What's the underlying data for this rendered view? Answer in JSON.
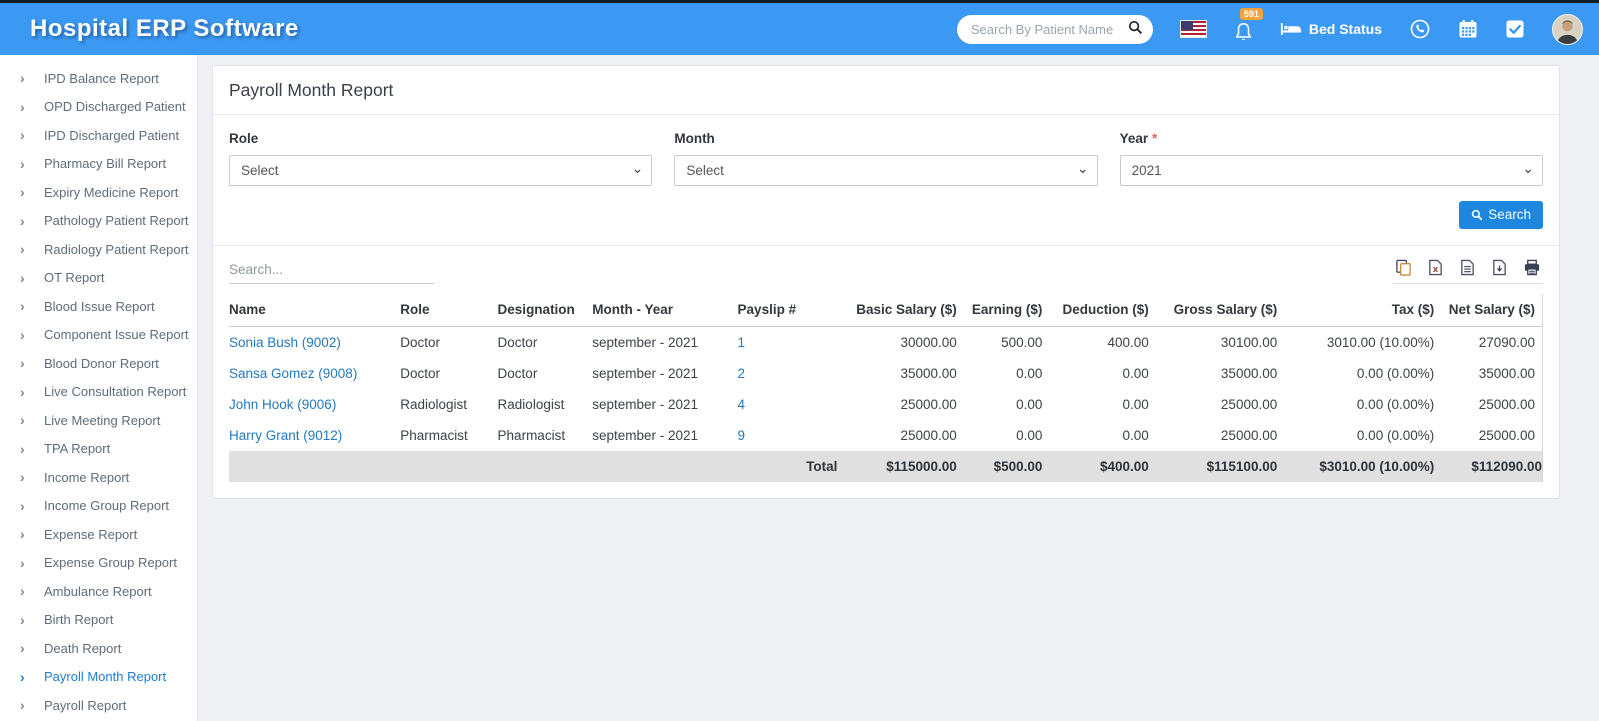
{
  "colors": {
    "header_blue": "#3b99f3",
    "accent_link": "#2479be",
    "button_blue": "#1d86df",
    "badge_orange": "#f2a33c",
    "active_item": "#1b7ed6",
    "total_row_bg": "#e0e0e0"
  },
  "header": {
    "title": "Hospital ERP Software",
    "search_placeholder": "Search By Patient Name",
    "notification_count": "591",
    "bed_status_label": "Bed Status"
  },
  "sidebar": {
    "items": [
      {
        "label": "IPD Balance Report",
        "active": false
      },
      {
        "label": "OPD Discharged Patient",
        "active": false
      },
      {
        "label": "IPD Discharged Patient",
        "active": false
      },
      {
        "label": "Pharmacy Bill Report",
        "active": false
      },
      {
        "label": "Expiry Medicine Report",
        "active": false
      },
      {
        "label": "Pathology Patient Report",
        "active": false
      },
      {
        "label": "Radiology Patient Report",
        "active": false
      },
      {
        "label": "OT Report",
        "active": false
      },
      {
        "label": "Blood Issue Report",
        "active": false
      },
      {
        "label": "Component Issue Report",
        "active": false
      },
      {
        "label": "Blood Donor Report",
        "active": false
      },
      {
        "label": "Live Consultation Report",
        "active": false
      },
      {
        "label": "Live Meeting Report",
        "active": false
      },
      {
        "label": "TPA Report",
        "active": false
      },
      {
        "label": "Income Report",
        "active": false
      },
      {
        "label": "Income Group Report",
        "active": false
      },
      {
        "label": "Expense Report",
        "active": false
      },
      {
        "label": "Expense Group Report",
        "active": false
      },
      {
        "label": "Ambulance Report",
        "active": false
      },
      {
        "label": "Birth Report",
        "active": false
      },
      {
        "label": "Death Report",
        "active": false
      },
      {
        "label": "Payroll Month Report",
        "active": true
      },
      {
        "label": "Payroll Report",
        "active": false
      }
    ]
  },
  "page": {
    "title": "Payroll Month Report",
    "filters": {
      "role_label": "Role",
      "role_value": "Select",
      "month_label": "Month",
      "month_value": "Select",
      "year_label": "Year",
      "year_required_mark": "*",
      "year_value": "2021",
      "search_button": "Search"
    },
    "table": {
      "filter_placeholder": "Search...",
      "export_icons": [
        "Copy",
        "Excel",
        "CSV",
        "PDF",
        "Print"
      ],
      "columns": [
        "Name",
        "Role",
        "Designation",
        "Month - Year",
        "Payslip #",
        "Basic Salary ($)",
        "Earning ($)",
        "Deduction ($)",
        "Gross Salary ($)",
        "Tax ($)",
        "Net Salary ($)"
      ],
      "rows": [
        {
          "name": "Sonia Bush (9002)",
          "role": "Doctor",
          "designation": "Doctor",
          "month_year": "september - 2021",
          "payslip": "1",
          "basic": "30000.00",
          "earning": "500.00",
          "deduction": "400.00",
          "gross": "30100.00",
          "tax": "3010.00 (10.00%)",
          "net": "27090.00"
        },
        {
          "name": "Sansa Gomez (9008)",
          "role": "Doctor",
          "designation": "Doctor",
          "month_year": "september - 2021",
          "payslip": "2",
          "basic": "35000.00",
          "earning": "0.00",
          "deduction": "0.00",
          "gross": "35000.00",
          "tax": "0.00 (0.00%)",
          "net": "35000.00"
        },
        {
          "name": "John Hook (9006)",
          "role": "Radiologist",
          "designation": "Radiologist",
          "month_year": "september - 2021",
          "payslip": "4",
          "basic": "25000.00",
          "earning": "0.00",
          "deduction": "0.00",
          "gross": "25000.00",
          "tax": "0.00 (0.00%)",
          "net": "25000.00"
        },
        {
          "name": "Harry Grant (9012)",
          "role": "Pharmacist",
          "designation": "Pharmacist",
          "month_year": "september - 2021",
          "payslip": "9",
          "basic": "25000.00",
          "earning": "0.00",
          "deduction": "0.00",
          "gross": "25000.00",
          "tax": "0.00 (0.00%)",
          "net": "25000.00"
        }
      ],
      "total": {
        "label": "Total",
        "basic": "$115000.00",
        "earning": "$500.00",
        "deduction": "$400.00",
        "gross": "$115100.00",
        "tax": "$3010.00 (10.00%)",
        "net": "$112090.00"
      }
    }
  }
}
